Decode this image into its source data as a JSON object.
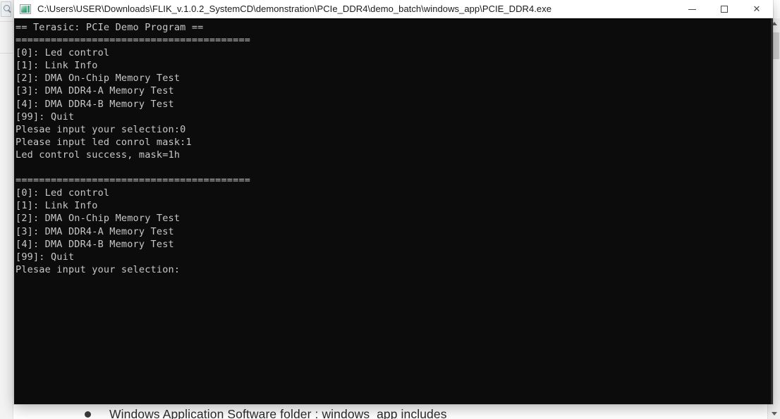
{
  "window": {
    "title": "C:\\Users\\USER\\Downloads\\FLIK_v.1.0.2_SystemCD\\demonstration\\PCIe_DDR4\\demo_batch\\windows_app\\PCIE_DDR4.exe",
    "icon": "console-app-icon",
    "controls": {
      "minimize_label": "—",
      "maximize_label": "□",
      "close_label": "✕"
    }
  },
  "console": {
    "background_color": "#0c0c0c",
    "text_color": "#c8c8c8",
    "lines": [
      "== Terasic: PCIe Demo Program ==",
      "========================================",
      "[0]: Led control",
      "[1]: Link Info",
      "[2]: DMA On-Chip Memory Test",
      "[3]: DMA DDR4-A Memory Test",
      "[4]: DMA DDR4-B Memory Test",
      "[99]: Quit",
      "Plesae input your selection:0",
      "Please input led conrol mask:1",
      "Led control success, mask=1h",
      "",
      "========================================",
      "[0]: Led control",
      "[1]: Link Info",
      "[2]: DMA On-Chip Memory Test",
      "[3]: DMA DDR4-A Memory Test",
      "[4]: DMA DDR4-B Memory Test",
      "[99]: Quit",
      "Plesae input your selection:"
    ]
  },
  "background_document": {
    "bullet_text": "Windows Application Software folder : windows_app includes",
    "scrollbar": {
      "up_arrow": "scroll-up-arrow",
      "down_arrow": "scroll-down-arrow"
    }
  }
}
